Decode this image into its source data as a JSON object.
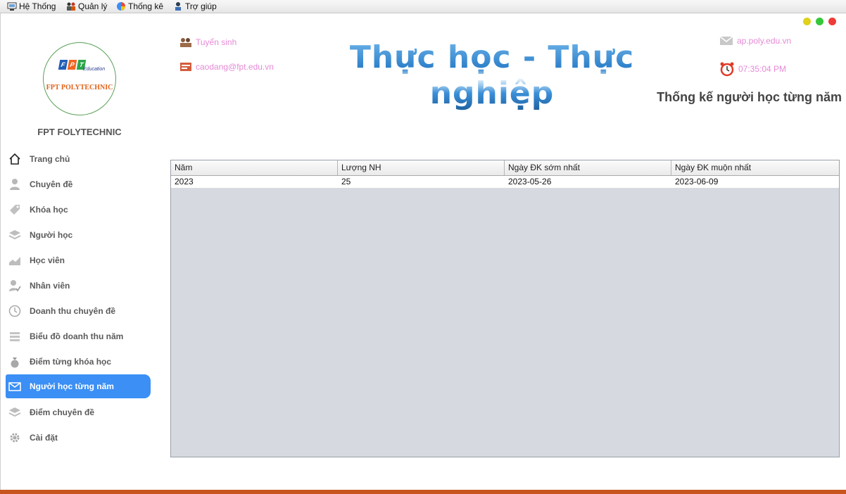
{
  "menubar": {
    "items": [
      {
        "label": "Hệ Thống",
        "icon": "system-icon"
      },
      {
        "label": "Quản lý",
        "icon": "management-icon"
      },
      {
        "label": "Thống kê",
        "icon": "statistics-icon"
      },
      {
        "label": "Trợ giúp",
        "icon": "help-icon"
      }
    ]
  },
  "window_controls": {
    "colors": [
      "#e0d11a",
      "#35c73a",
      "#ef3b36"
    ]
  },
  "logo": {
    "badge_letters": [
      "F",
      "P",
      "T"
    ],
    "badge_colors": [
      "#1f5fb8",
      "#f26522",
      "#2ca54a"
    ],
    "education": "Education",
    "name": "FPT POLYTECHNIC"
  },
  "brand": "FPT FOLYTECHNIC",
  "sidebar": {
    "items": [
      {
        "label": "Trang chủ",
        "icon": "home-icon"
      },
      {
        "label": "Chuyên đề",
        "icon": "user-icon"
      },
      {
        "label": "Khóa học",
        "icon": "tag-icon"
      },
      {
        "label": "Người học",
        "icon": "layers-icon"
      },
      {
        "label": "Học viên",
        "icon": "chart-icon"
      },
      {
        "label": "Nhân viên",
        "icon": "user-check-icon"
      },
      {
        "label": "Doanh thu chuyên đề",
        "icon": "clock-icon"
      },
      {
        "label": "Biểu đồ doanh thu năm",
        "icon": "stack-icon"
      },
      {
        "label": "Điểm từng khóa học",
        "icon": "money-bag-icon"
      },
      {
        "label": "Người học từng năm",
        "icon": "mail-icon",
        "active": true
      },
      {
        "label": "Điểm chuyên đề",
        "icon": "layers-icon"
      },
      {
        "label": "Cài đặt",
        "icon": "gear-icon"
      }
    ]
  },
  "header": {
    "admission": "Tuyển sinh",
    "email": "caodang@fpt.edu.vn",
    "website": "ap.poly.edu.vn",
    "clock": "07:35:04 PM",
    "slogan": "Thực học - Thực nghiệp",
    "link_color": "#e58ad6"
  },
  "page_title": "Thống kế người học từng năm",
  "table": {
    "columns": [
      "Năm",
      "Lượng NH",
      "Ngày ĐK sớm nhất",
      "Ngày ĐK muộn nhất"
    ],
    "rows": [
      [
        "2023",
        "25",
        "2023-05-26",
        "2023-06-09"
      ]
    ]
  },
  "accent_color": "#3b8ff5"
}
